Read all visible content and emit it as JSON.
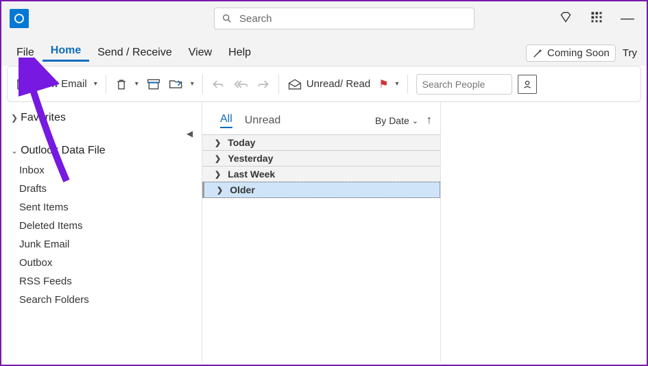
{
  "titlebar": {
    "search_placeholder": "Search"
  },
  "menubar": {
    "tabs": {
      "file": "File",
      "home": "Home",
      "sendrecv": "Send / Receive",
      "view": "View",
      "help": "Help"
    },
    "coming_soon": "Coming Soon",
    "try": "Try"
  },
  "ribbon": {
    "new_email": "New Email",
    "unread_read": "Unread/ Read",
    "search_people_placeholder": "Search People"
  },
  "sidebar": {
    "favorites": "Favorites",
    "data_file": "Outlook Data File",
    "folders": {
      "inbox": "Inbox",
      "drafts": "Drafts",
      "sent": "Sent Items",
      "deleted": "Deleted Items",
      "junk": "Junk Email",
      "outbox": "Outbox",
      "rss": "RSS Feeds",
      "search": "Search Folders"
    }
  },
  "maillist": {
    "filters": {
      "all": "All",
      "unread": "Unread"
    },
    "sort_label": "By Date",
    "groups": {
      "today": "Today",
      "yesterday": "Yesterday",
      "lastweek": "Last Week",
      "older": "Older"
    }
  }
}
